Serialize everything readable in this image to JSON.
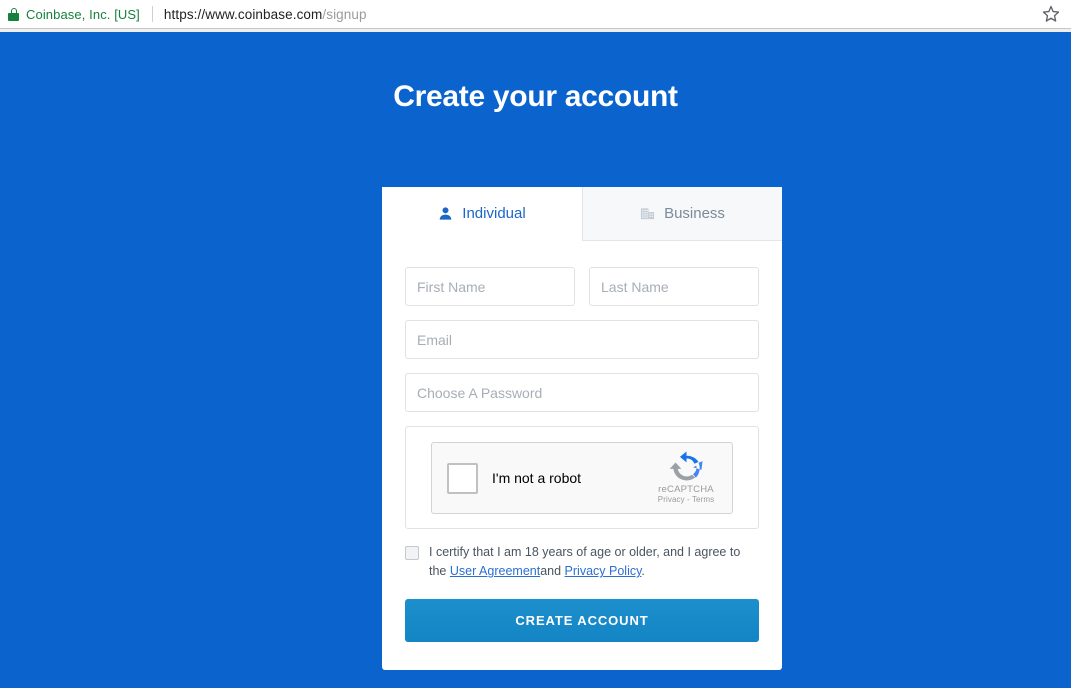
{
  "browser": {
    "security_icon": "lock-icon",
    "site_identity": "Coinbase, Inc. [US]",
    "url_origin": "https://www.coinbase.com",
    "url_path": "/signup",
    "bookmark_icon": "star-icon"
  },
  "page": {
    "title": "Create your account",
    "background_color": "#0b63ce"
  },
  "tabs": [
    {
      "id": "individual",
      "label": "Individual",
      "icon": "person-icon",
      "active": true
    },
    {
      "id": "business",
      "label": "Business",
      "icon": "building-icon",
      "active": false
    }
  ],
  "form": {
    "first_name_placeholder": "First Name",
    "first_name_value": "",
    "last_name_placeholder": "Last Name",
    "last_name_value": "",
    "email_placeholder": "Email",
    "email_value": "",
    "password_placeholder": "Choose A Password",
    "password_value": ""
  },
  "recaptcha": {
    "checkbox_label": "I'm not a robot",
    "brand_name": "reCAPTCHA",
    "links_text": "Privacy - Terms",
    "logo_icon": "recaptcha-logo-icon",
    "checked": false
  },
  "consent": {
    "checked": false,
    "text_before": "I certify that I am 18 years of age or older, and I agree to the",
    "link_user_agreement": "User Agreement",
    "text_between": "and",
    "link_privacy_policy": "Privacy Policy",
    "text_after": "."
  },
  "submit": {
    "label": "CREATE ACCOUNT",
    "accent_color": "#1787c6"
  }
}
